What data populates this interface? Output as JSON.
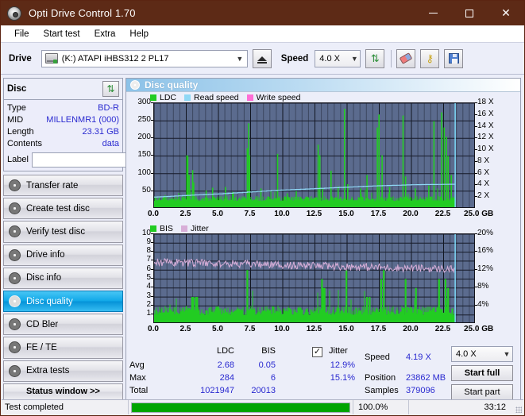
{
  "window": {
    "title": "Opti Drive Control 1.70",
    "app_icon": "disc-icon",
    "minimize": "–",
    "maximize": "□",
    "close": "✕"
  },
  "menu": {
    "items": [
      "File",
      "Start test",
      "Extra",
      "Help"
    ]
  },
  "toolbar": {
    "drive_label": "Drive",
    "drive_value": "(K:)  ATAPI iHBS312   2 PL17",
    "eject_icon": "eject-icon",
    "speed_label": "Speed",
    "speed_value": "4.0 X",
    "refresh_icon": "refresh-icon",
    "eraser_icon": "eraser-icon",
    "key_icon": "key-icon",
    "save_icon": "save-icon"
  },
  "disc_panel": {
    "title": "Disc",
    "refresh_icon": "swap-disc-icon",
    "rows": [
      {
        "key": "Type",
        "value": "BD-R"
      },
      {
        "key": "MID",
        "value": "MILLENMR1 (000)"
      },
      {
        "key": "Length",
        "value": "23.31 GB"
      },
      {
        "key": "Contents",
        "value": "data"
      }
    ],
    "label_key": "Label",
    "label_value": "",
    "label_placeholder": "",
    "label_icon": "disc-icon"
  },
  "sidebar": {
    "items": [
      {
        "label": "Transfer rate",
        "icon": "disc-icon",
        "active": false
      },
      {
        "label": "Create test disc",
        "icon": "disc-icon",
        "active": false
      },
      {
        "label": "Verify test disc",
        "icon": "disc-icon",
        "active": false
      },
      {
        "label": "Drive info",
        "icon": "disc-icon",
        "active": false
      },
      {
        "label": "Disc info",
        "icon": "disc-icon",
        "active": false
      },
      {
        "label": "Disc quality",
        "icon": "disc-icon",
        "active": true
      },
      {
        "label": "CD Bler",
        "icon": "disc-icon",
        "active": false
      },
      {
        "label": "FE / TE",
        "icon": "disc-icon",
        "active": false
      },
      {
        "label": "Extra tests",
        "icon": "disc-icon",
        "active": false
      }
    ],
    "status_window_button": "Status window >>"
  },
  "main": {
    "header_title": "Disc quality",
    "header_icon": "disc-icon"
  },
  "stats": {
    "col_headers": [
      "LDC",
      "BIS",
      "Jitter"
    ],
    "row_labels": [
      "Avg",
      "Max",
      "Total"
    ],
    "ldc": {
      "avg": "2.68",
      "max": "284",
      "total": "1021947"
    },
    "bis": {
      "avg": "0.05",
      "max": "6",
      "total": "20013"
    },
    "jitter": {
      "label": "Jitter",
      "checked": true,
      "avg": "12.9%",
      "max": "15.1%"
    },
    "speed_label": "Speed",
    "speed_value": "4.19 X",
    "position_label": "Position",
    "position_value": "23862 MB",
    "samples_label": "Samples",
    "samples_value": "379096",
    "speed_select": "4.0 X",
    "start_full": "Start full",
    "start_part": "Start part"
  },
  "statusbar": {
    "text": "Test completed",
    "progress_pct": "100.0%",
    "progress_value": 100,
    "elapsed": "33:12"
  },
  "colors": {
    "title_bar": "#5d2a16",
    "plot_bg": "#5b6b8e",
    "ldc_green": "#22cc22",
    "bis_green": "#22cc22",
    "read_speed": "#8fd8f5",
    "write_speed": "#ff6ed6",
    "jitter_pink": "#d8aed8",
    "accent_blue": "#2a2ad0",
    "progress_green": "#00a400",
    "active_nav": "#11a8e8"
  },
  "chart_data": [
    {
      "type": "line",
      "id": "ldc-chart",
      "title": "LDC / Read speed / Write speed vs position",
      "legend": [
        {
          "label": "LDC",
          "color": "#22cc22"
        },
        {
          "label": "Read speed",
          "color": "#8fd8f5"
        },
        {
          "label": "Write speed",
          "color": "#ff6ed6"
        }
      ],
      "legend_position": "top-left",
      "xlabel": "GB",
      "ylabel": "LDC",
      "y2label": "X",
      "xlim": [
        0.0,
        25.0
      ],
      "xticks": [
        0.0,
        2.5,
        5.0,
        7.5,
        10.0,
        12.5,
        15.0,
        17.5,
        20.0,
        22.5,
        25.0
      ],
      "xticklabels": [
        "0.0",
        "2.5",
        "5.0",
        "7.5",
        "10.0",
        "12.5",
        "15.0",
        "17.5",
        "20.0",
        "22.5",
        "25.0 GB"
      ],
      "ylim": [
        0,
        300
      ],
      "yticks": [
        50,
        100,
        150,
        200,
        250,
        300
      ],
      "yticklabels": [
        "50",
        "100",
        "150",
        "200",
        "250",
        "300"
      ],
      "y2lim": [
        0,
        18
      ],
      "y2ticks": [
        2,
        4,
        6,
        8,
        10,
        12,
        14,
        16,
        18
      ],
      "y2ticklabels": [
        "2 X",
        "4 X",
        "6 X",
        "8 X",
        "10 X",
        "12 X",
        "14 X",
        "16 X",
        "18 X"
      ],
      "grid": true,
      "data_end_gb": 23.4,
      "series": [
        {
          "name": "LDC",
          "color": "#22cc22",
          "kind": "spikes",
          "baseline": 22,
          "noise_amp": 14,
          "spikes": [
            [
              2.55,
              152
            ],
            [
              2.62,
              150
            ],
            [
              2.72,
              96
            ],
            [
              3.0,
              110
            ],
            [
              3.08,
              75
            ],
            [
              4.05,
              52
            ],
            [
              4.55,
              60
            ],
            [
              5.55,
              62
            ],
            [
              6.1,
              48
            ],
            [
              7.25,
              172
            ],
            [
              7.35,
              243
            ],
            [
              7.42,
              152
            ],
            [
              8.3,
              58
            ],
            [
              9.6,
              156
            ],
            [
              10.35,
              44
            ],
            [
              11.05,
              50
            ],
            [
              12.75,
              182
            ],
            [
              12.88,
              152
            ],
            [
              13.1,
              60
            ],
            [
              13.75,
              108
            ],
            [
              14.3,
              64
            ],
            [
              14.8,
              284
            ],
            [
              15.05,
              70
            ],
            [
              16.05,
              58
            ],
            [
              16.55,
              96
            ],
            [
              17.35,
              231
            ],
            [
              17.48,
              268
            ],
            [
              17.72,
              152
            ],
            [
              18.3,
              62
            ],
            [
              19.35,
              265
            ],
            [
              19.55,
              92
            ],
            [
              20.3,
              58
            ],
            [
              21.35,
              66
            ],
            [
              21.75,
              249
            ],
            [
              22.35,
              274
            ],
            [
              22.55,
              231
            ],
            [
              22.72,
              205
            ],
            [
              22.85,
              150
            ],
            [
              23.1,
              96
            ]
          ]
        },
        {
          "name": "Read speed",
          "color": "#8fd8f5",
          "kind": "step-line",
          "points": [
            [
              0.0,
              2.0
            ],
            [
              1.0,
              2.1
            ],
            [
              2.2,
              2.25
            ],
            [
              3.5,
              2.4
            ],
            [
              5.0,
              2.55
            ],
            [
              6.5,
              2.75
            ],
            [
              8.0,
              2.95
            ],
            [
              9.5,
              3.15
            ],
            [
              11.0,
              3.3
            ],
            [
              12.5,
              3.45
            ],
            [
              14.0,
              3.6
            ],
            [
              15.5,
              3.75
            ],
            [
              17.0,
              3.9
            ],
            [
              18.5,
              4.0
            ],
            [
              20.0,
              4.1
            ],
            [
              21.5,
              4.15
            ],
            [
              23.4,
              4.19
            ]
          ]
        }
      ],
      "cursor_gb": 23.4
    },
    {
      "type": "line",
      "id": "bis-chart",
      "title": "BIS / Jitter vs position",
      "legend": [
        {
          "label": "BIS",
          "color": "#22cc22"
        },
        {
          "label": "Jitter",
          "color": "#d8aed8"
        }
      ],
      "legend_position": "top-left",
      "xlabel": "GB",
      "ylabel": "BIS",
      "y2label": "%",
      "xlim": [
        0.0,
        25.0
      ],
      "xticks": [
        0.0,
        2.5,
        5.0,
        7.5,
        10.0,
        12.5,
        15.0,
        17.5,
        20.0,
        22.5,
        25.0
      ],
      "xticklabels": [
        "0.0",
        "2.5",
        "5.0",
        "7.5",
        "10.0",
        "12.5",
        "15.0",
        "17.5",
        "20.0",
        "22.5",
        "25.0 GB"
      ],
      "ylim": [
        0,
        10
      ],
      "yticks": [
        1,
        2,
        3,
        4,
        5,
        6,
        7,
        8,
        9,
        10
      ],
      "yticklabels": [
        "1",
        "2",
        "3",
        "4",
        "5",
        "6",
        "7",
        "8",
        "9",
        "10"
      ],
      "y2lim": [
        0,
        20
      ],
      "y2ticks": [
        4,
        8,
        12,
        16,
        20
      ],
      "y2ticklabels": [
        "4%",
        "8%",
        "12%",
        "16%",
        "20%"
      ],
      "grid": true,
      "data_end_gb": 23.4,
      "series": [
        {
          "name": "BIS",
          "color": "#22cc22",
          "kind": "spikes",
          "baseline": 1.0,
          "noise_amp": 1.0,
          "spikes": [
            [
              2.95,
              3
            ],
            [
              3.05,
              3
            ],
            [
              3.25,
              3
            ],
            [
              3.35,
              3
            ],
            [
              7.25,
              6
            ],
            [
              13.05,
              5
            ],
            [
              13.15,
              4
            ],
            [
              13.25,
              4
            ],
            [
              14.95,
              6
            ],
            [
              16.55,
              3
            ],
            [
              16.75,
              3
            ],
            [
              17.65,
              5
            ],
            [
              17.85,
              6
            ],
            [
              19.55,
              5
            ],
            [
              20.35,
              4
            ],
            [
              22.15,
              5
            ],
            [
              22.65,
              5
            ],
            [
              22.85,
              4
            ]
          ]
        },
        {
          "name": "Jitter",
          "color": "#d8aed8",
          "kind": "noisy-line",
          "start_value": 6.9,
          "end_value": 6.1,
          "noise_amp": 0.42
        }
      ],
      "cursor_gb": 23.4
    }
  ]
}
